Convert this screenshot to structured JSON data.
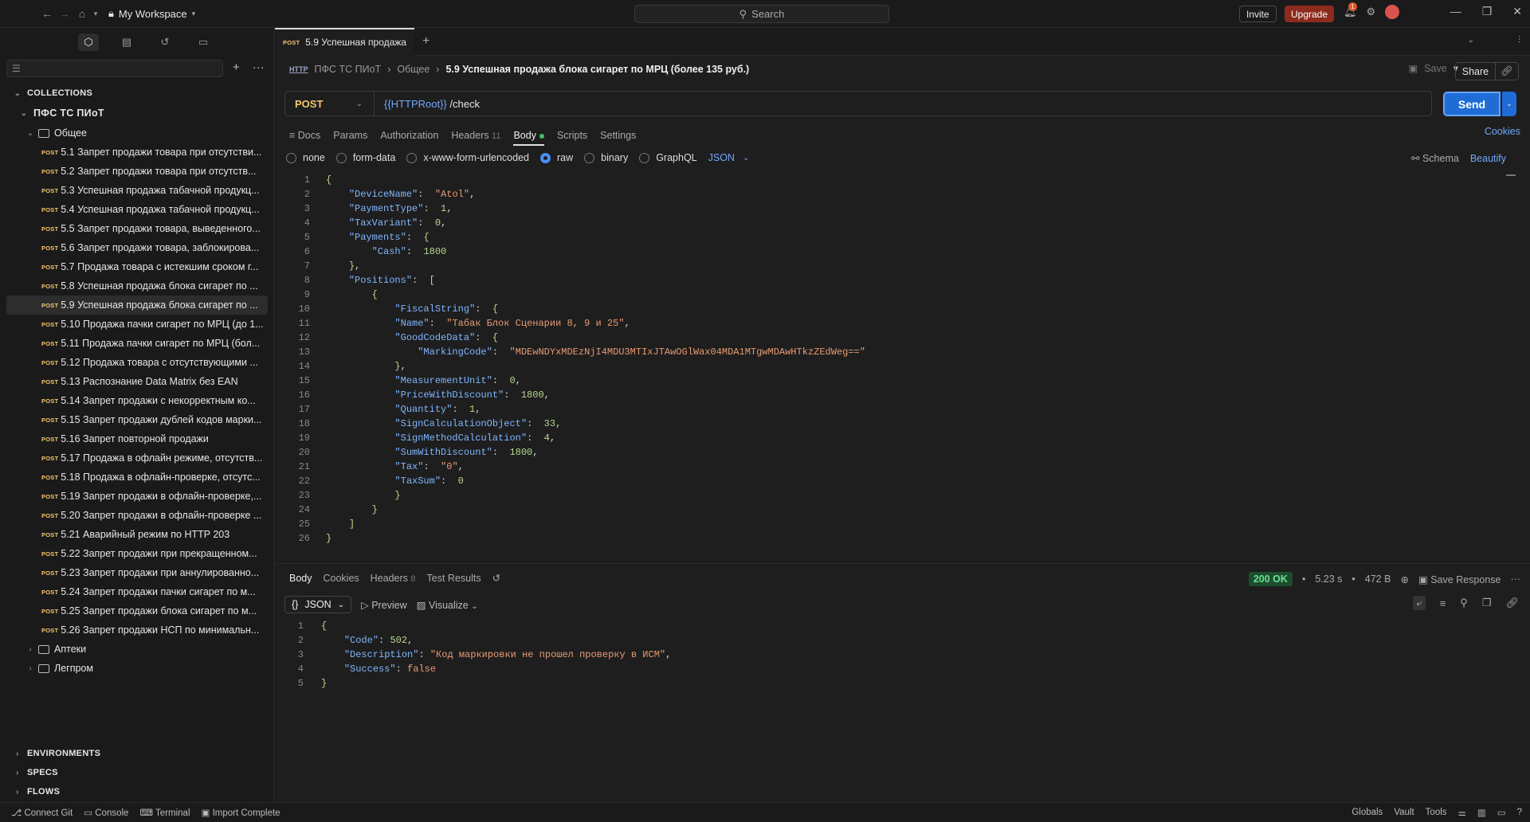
{
  "topbar": {
    "workspace": "My Workspace",
    "search_placeholder": "Search",
    "invite": "Invite",
    "upgrade": "Upgrade",
    "notif_count": "1"
  },
  "sidebar": {
    "collections_label": "COLLECTIONS",
    "collection_name": "ПФС ТС ПИоТ",
    "folder_name": "Общее",
    "method_tag": "POST",
    "items": [
      "5.1 Запрет продажи товара при отсутстви...",
      "5.2 Запрет продажи товара при отсутств...",
      "5.3 Успешная продажа табачной продукц...",
      "5.4 Успешная продажа табачной продукц...",
      "5.5 Запрет продажи товара, выведенного...",
      "5.6 Запрет продажи товара, заблокирова...",
      "5.7 Продажа товара с истекшим сроком г...",
      "5.8 Успешная продажа блока сигарет по ...",
      "5.9 Успешная продажа блока сигарет по ...",
      "5.10 Продажа пачки сигарет по МРЦ (до 1...",
      "5.11 Продажа пачки сигарет по МРЦ (бол...",
      "5.12 Продажа товара с отсутствующими ...",
      "5.13 Распознание Data Matrix без EAN",
      "5.14 Запрет продажи с некорректным ко...",
      "5.15 Запрет продажи дублей кодов марки...",
      "5.16 Запрет повторной продажи",
      "5.17 Продажа в офлайн режиме, отсутств...",
      "5.18 Продажа в офлайн-проверке, отсутс...",
      "5.19 Запрет продажи в офлайн-проверке,...",
      "5.20 Запрет продажи в офлайн-проверке ...",
      "5.21 Аварийный режим по HTTP 203",
      "5.22 Запрет продажи при прекращенном...",
      "5.23 Запрет продажи при аннулированно...",
      "5.24 Запрет продажи пачки сигарет по м...",
      "5.25 Запрет продажи блока сигарет по м...",
      "5.26 Запрет продажи НСП по минимальн..."
    ],
    "other_folders": [
      "Аптеки",
      "Легпром"
    ],
    "bottom_sections": [
      "ENVIRONMENTS",
      "SPECS",
      "FLOWS"
    ]
  },
  "tab": {
    "method": "POST",
    "title": "5.9 Успешная продажа"
  },
  "breadcrumb": {
    "icon": "HTTP",
    "root": "ПФС ТС ПИоТ",
    "folder": "Общее",
    "current": "5.9 Успешная продажа блока сигарет по МРЦ (более 135 руб.)"
  },
  "actions": {
    "save": "Save",
    "share": "Share"
  },
  "request": {
    "method": "POST",
    "url_var": "{{HTTPRoot}}",
    "url_path": " /check",
    "send": "Send"
  },
  "req_tabs": {
    "docs": "Docs",
    "params": "Params",
    "authorization": "Authorization",
    "headers": "Headers",
    "headers_count": "11",
    "body": "Body",
    "scripts": "Scripts",
    "settings": "Settings",
    "cookies": "Cookies"
  },
  "body_types": {
    "none": "none",
    "form_data": "form-data",
    "urlencoded": "x-www-form-urlencoded",
    "raw": "raw",
    "binary": "binary",
    "graphql": "GraphQL",
    "json": "JSON",
    "schema": "Schema",
    "beautify": "Beautify"
  },
  "request_body": [
    "{",
    "    \"DeviceName\":  \"Atol\",",
    "    \"PaymentType\":  1,",
    "    \"TaxVariant\":  0,",
    "    \"Payments\":  {",
    "        \"Cash\":  1800",
    "    },",
    "    \"Positions\":  [",
    "        {",
    "            \"FiscalString\":  {",
    "            \"Name\":  \"Табак Блок Сценарии 8, 9 и 25\",",
    "            \"GoodCodeData\":  {",
    "                \"MarkingCode\":  \"MDEwNDYxMDEzNjI4MDU3MTIxJTAwOGlWax04MDA1MTgwMDAwHTkzZEdWeg==\"",
    "            },",
    "            \"MeasurementUnit\":  0,",
    "            \"PriceWithDiscount\":  1800,",
    "            \"Quantity\":  1,",
    "            \"SignCalculationObject\":  33,",
    "            \"SignMethodCalculation\":  4,",
    "            \"SumWithDiscount\":  1800,",
    "            \"Tax\":  \"0\",",
    "            \"TaxSum\":  0",
    "            }",
    "        }",
    "    ]",
    "}"
  ],
  "response": {
    "tabs": {
      "body": "Body",
      "cookies": "Cookies",
      "headers": "Headers",
      "headers_count": "8",
      "test_results": "Test Results"
    },
    "status": "200 OK",
    "time": "5.23 s",
    "size": "472 B",
    "save_response": "Save Response",
    "format": "JSON",
    "preview": "Preview",
    "visualize": "Visualize",
    "body": [
      "{",
      "    \"Code\": 502,",
      "    \"Description\": \"Код маркировки не прошел проверку в ИСМ\",",
      "    \"Success\": false",
      "}"
    ]
  },
  "statusbar": {
    "connect_git": "Connect Git",
    "console": "Console",
    "terminal": "Terminal",
    "import_complete": "Import Complete",
    "globals": "Globals",
    "vault": "Vault",
    "tools": "Tools"
  },
  "colors": {
    "accent": "#1f6cd6",
    "post": "#f4c66e",
    "upgrade": "#8c2b1d",
    "status_ok": "#6de092"
  }
}
